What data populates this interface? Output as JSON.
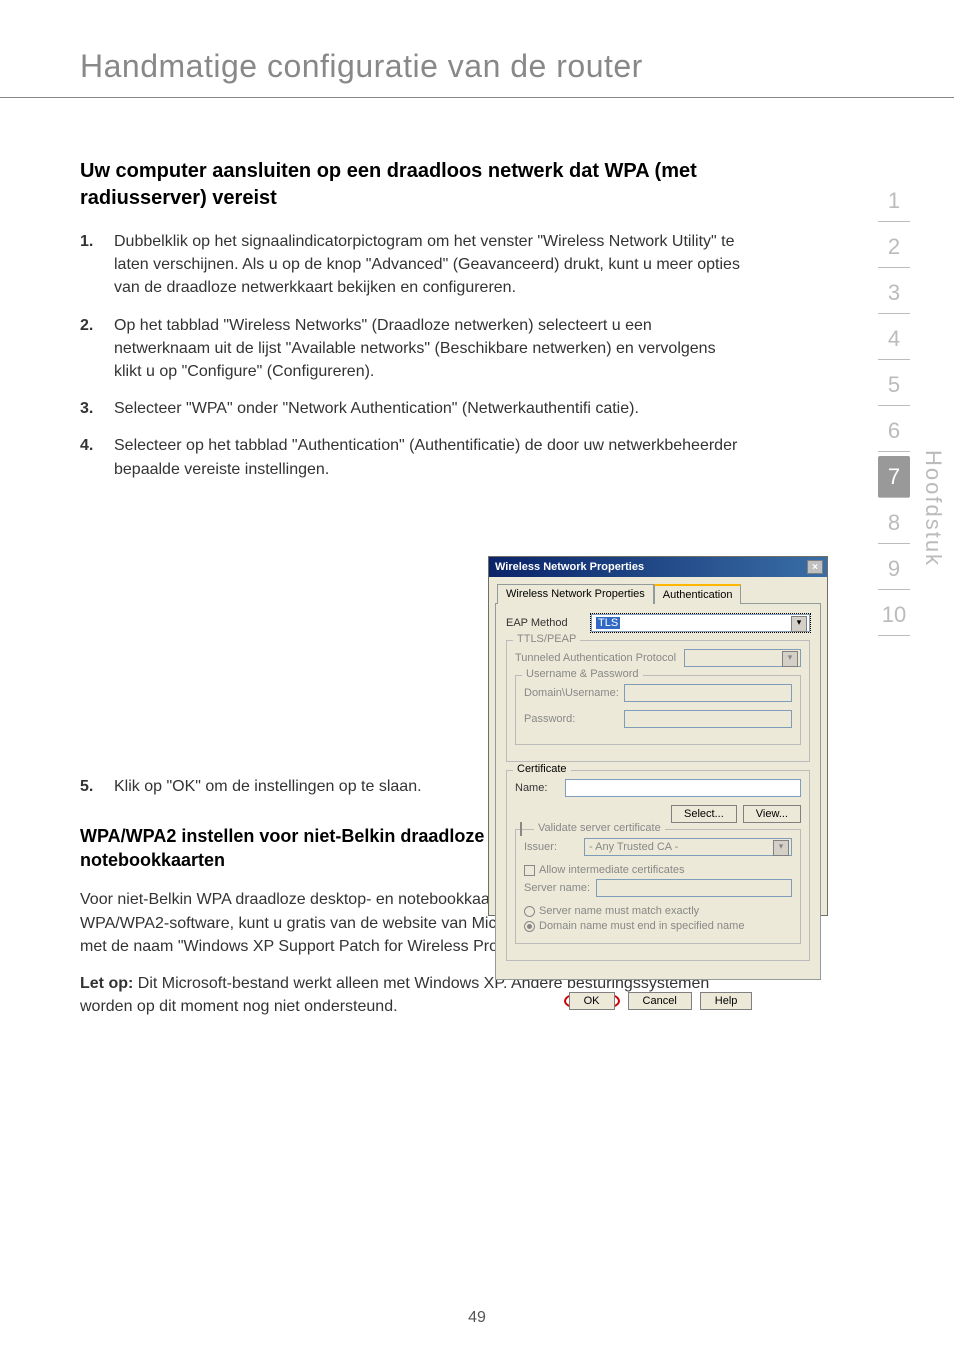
{
  "header": {
    "title": "Handmatige configuratie van de router"
  },
  "nav": {
    "items": [
      "1",
      "2",
      "3",
      "4",
      "5",
      "6",
      "7",
      "8",
      "9",
      "10"
    ],
    "active": "7",
    "side_label": "Hoofdstuk"
  },
  "section1": {
    "title": "Uw computer aansluiten op een draadloos netwerk dat WPA (met radiusserver) vereist",
    "steps": [
      {
        "n": "1.",
        "t": "Dubbelklik op het signaalindicatorpictogram om het venster \"Wireless Network Utility\" te laten verschijnen. Als u op de knop \"Advanced\" (Geavanceerd) drukt, kunt u meer opties van de draadloze netwerkkaart bekijken en configureren."
      },
      {
        "n": "2.",
        "t": "Op het tabblad \"Wireless Networks\" (Draadloze netwerken) selecteert u een netwerknaam uit de lijst \"Available networks\" (Beschikbare netwerken) en vervolgens klikt u op \"Configure\" (Configureren)."
      },
      {
        "n": "3.",
        "t": "Selecteer \"WPA\" onder \"Network Authentication\" (Netwerkauthentifi catie)."
      },
      {
        "n": "4.",
        "t_pre": "Selecteer op het tabblad \"Authentication\" (Authentificatie) de door uw netwerkbeheerder bepaalde vereiste instellingen."
      },
      {
        "n": "5.",
        "t": "Klik op \"OK\" om de instellingen op te slaan."
      }
    ]
  },
  "section2": {
    "subhead": "WPA/WPA2 instellen voor niet-Belkin draadloze desktop- en notebookkaarten",
    "p1": "Voor niet-Belkin WPA draadloze desktop- en notebookkaarten die niet zijn voorzien van WPA/WPA2-software, kunt u gratis van de website van Microsoft een bestand downloaden met de naam \"Windows XP Support Patch for Wireless Protected Access\".",
    "p2_bold": "Let op:",
    "p2_rest": "  Dit Microsoft-bestand werkt alleen met Windows XP. Andere besturingssystemen worden op dit moment nog niet ondersteund."
  },
  "dialog": {
    "title": "Wireless Network Properties",
    "tabs": {
      "tab1": "Wireless Network Properties",
      "tab2": "Authentication"
    },
    "eap_label": "EAP Method",
    "eap_value": "TLS",
    "group_ttls": "TTLS/PEAP",
    "tunneled_label": "Tunneled Authentication Protocol",
    "group_up": "Username & Password",
    "domain_label": "Domain\\Username:",
    "password_label": "Password:",
    "group_cert": "Certificate",
    "name_label": "Name:",
    "btn_select": "Select...",
    "btn_view": "View...",
    "validate_label": "Validate server certificate",
    "issuer_label": "Issuer:",
    "issuer_value": "- Any Trusted CA -",
    "allow_label": "Allow intermediate certificates",
    "server_label": "Server name:",
    "radio1": "Server name must match exactly",
    "radio2": "Domain name must end in specified name",
    "btn_ok": "OK",
    "btn_cancel": "Cancel",
    "btn_help": "Help"
  },
  "page_number": "49"
}
